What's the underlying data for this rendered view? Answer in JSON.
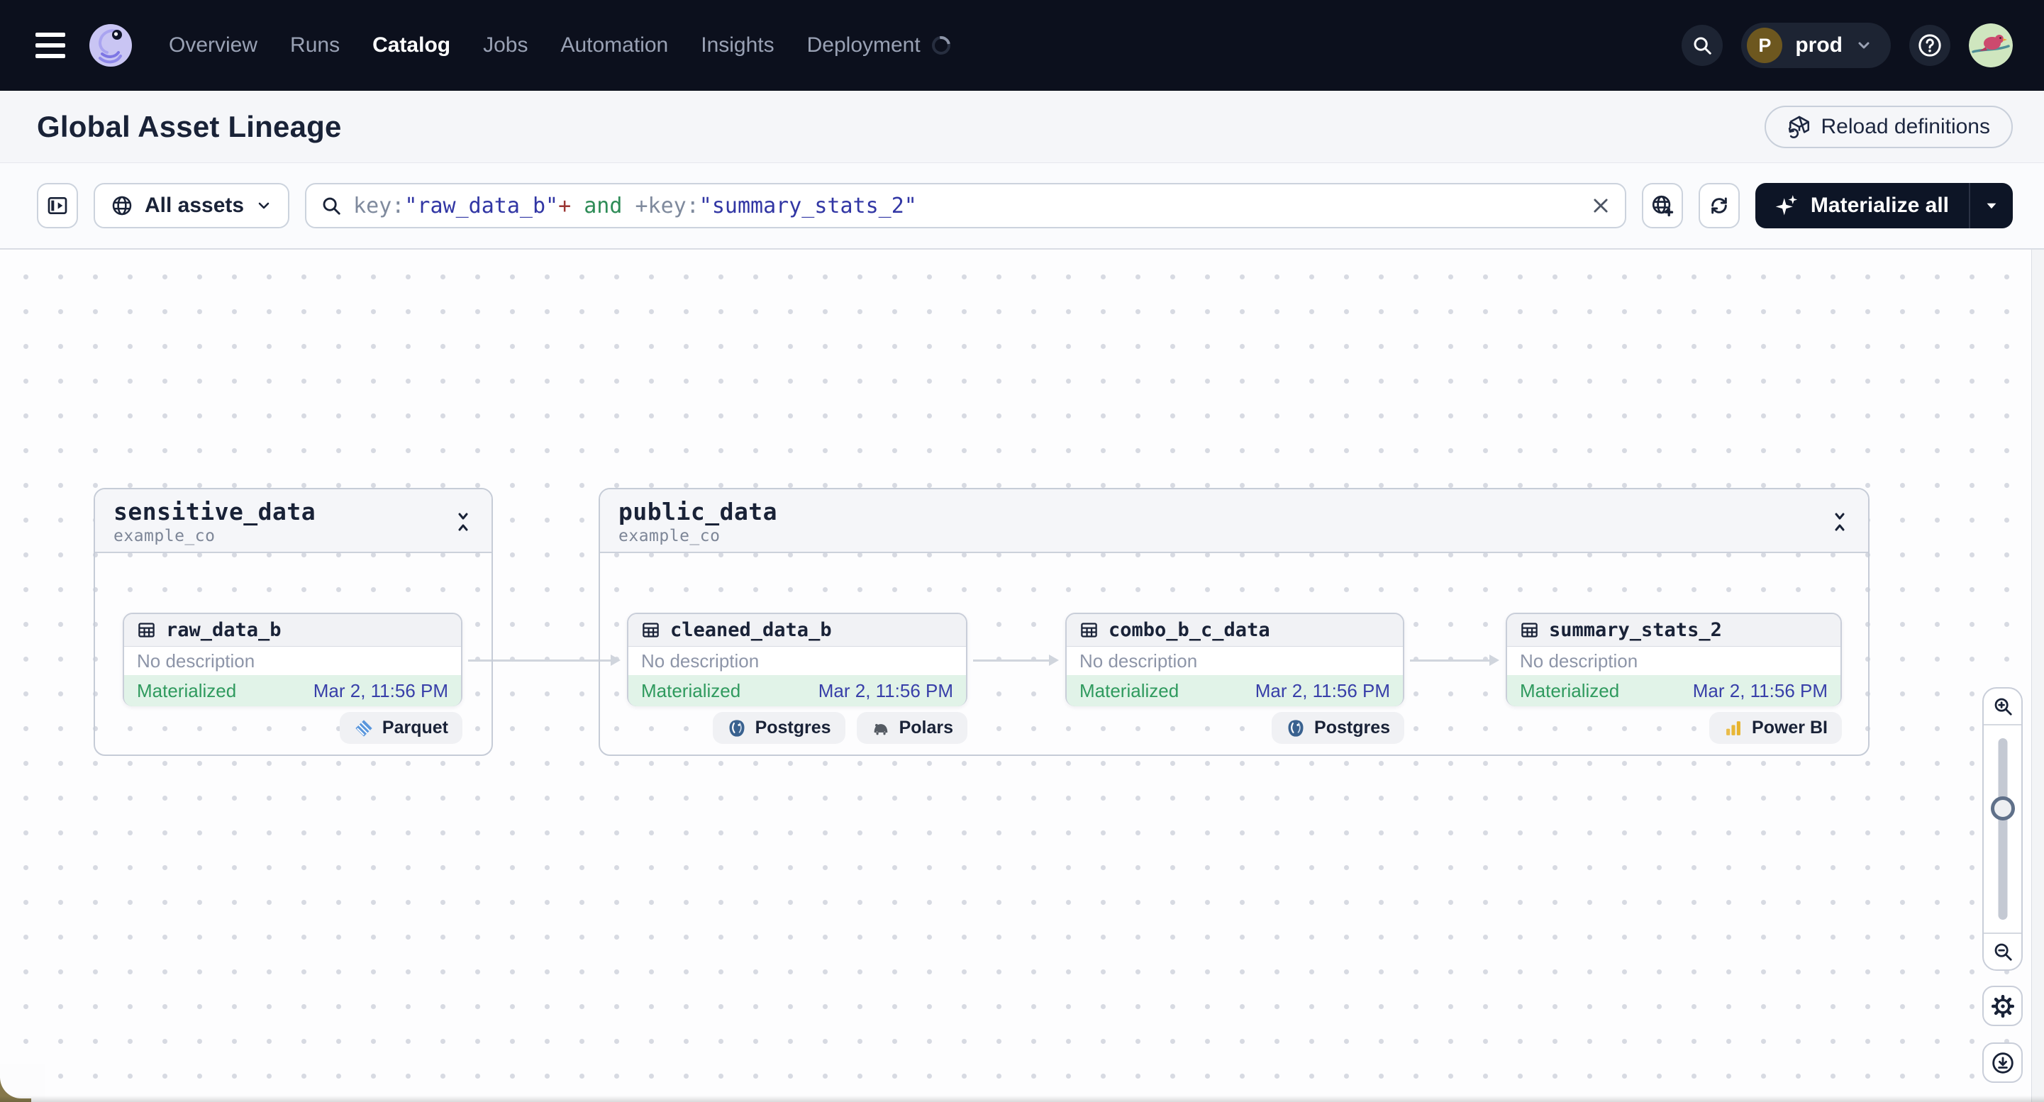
{
  "navbar": {
    "items": [
      {
        "label": "Overview",
        "active": false
      },
      {
        "label": "Runs",
        "active": false
      },
      {
        "label": "Catalog",
        "active": true
      },
      {
        "label": "Jobs",
        "active": false
      },
      {
        "label": "Automation",
        "active": false
      },
      {
        "label": "Insights",
        "active": false
      },
      {
        "label": "Deployment",
        "active": false,
        "loading": true
      }
    ],
    "environment": {
      "initial": "P",
      "name": "prod"
    }
  },
  "header": {
    "title": "Global Asset Lineage",
    "reload_button": "Reload definitions"
  },
  "toolbar": {
    "asset_scope": "All assets",
    "materialize_label": "Materialize all",
    "query_segments": [
      {
        "text": "key:",
        "role": "key"
      },
      {
        "text": "\"raw_data_b\"",
        "role": "value"
      },
      {
        "text": "+",
        "role": "op"
      },
      {
        "text": " and ",
        "role": "bool"
      },
      {
        "text": "+",
        "role": "key"
      },
      {
        "text": "key:",
        "role": "key"
      },
      {
        "text": "\"summary_stats_2\"",
        "role": "value"
      }
    ]
  },
  "syntax_colors": {
    "key": "#7f8a9d",
    "value": "#3136a4",
    "op": "#9b3633",
    "bool": "#2e8c57"
  },
  "graph": {
    "groups": [
      {
        "name": "sensitive_data",
        "repo": "example_co",
        "assets": [
          {
            "name": "raw_data_b",
            "description": "No description",
            "status": "Materialized",
            "timestamp": "Mar 2, 11:56 PM",
            "tags": [
              {
                "label": "Parquet",
                "icon": "parquet"
              }
            ]
          }
        ]
      },
      {
        "name": "public_data",
        "repo": "example_co",
        "assets": [
          {
            "name": "cleaned_data_b",
            "description": "No description",
            "status": "Materialized",
            "timestamp": "Mar 2, 11:56 PM",
            "tags": [
              {
                "label": "Postgres",
                "icon": "postgres"
              },
              {
                "label": "Polars",
                "icon": "polars"
              }
            ]
          },
          {
            "name": "combo_b_c_data",
            "description": "No description",
            "status": "Materialized",
            "timestamp": "Mar 2, 11:56 PM",
            "tags": [
              {
                "label": "Postgres",
                "icon": "postgres"
              }
            ]
          },
          {
            "name": "summary_stats_2",
            "description": "No description",
            "status": "Materialized",
            "timestamp": "Mar 2, 11:56 PM",
            "tags": [
              {
                "label": "Power BI",
                "icon": "powerbi"
              }
            ]
          }
        ]
      }
    ],
    "edges": [
      {
        "from": "raw_data_b",
        "to": "cleaned_data_b"
      },
      {
        "from": "cleaned_data_b",
        "to": "combo_b_c_data"
      },
      {
        "from": "combo_b_c_data",
        "to": "summary_stats_2"
      }
    ]
  }
}
